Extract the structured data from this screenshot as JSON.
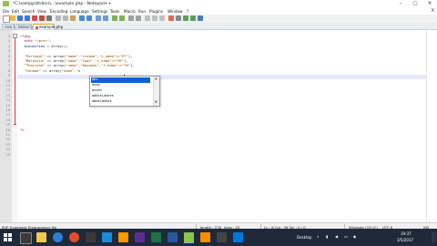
{
  "window": {
    "title": "*C:\\xampp\\htdocs\\...\\example.php - Notepad++",
    "buttons": [
      "–",
      "▢",
      "✕"
    ]
  },
  "menu": [
    "File",
    "Edit",
    "Search",
    "View",
    "Encoding",
    "Language",
    "Settings",
    "Tools",
    "Macro",
    "Run",
    "Plugins",
    "Window",
    "?"
  ],
  "menu_close": "X",
  "tabs": [
    {
      "label": "new 1",
      "state": "inactive"
    },
    {
      "label": "bbiberi.php",
      "state": "inactive"
    },
    {
      "label": "example.php",
      "state": "active"
    }
  ],
  "code": {
    "line_numbers": [
      "1",
      "2",
      "3",
      "4",
      "5",
      "6",
      "7",
      "8",
      "9",
      "10",
      "11",
      "12",
      "13",
      "14",
      "15",
      "16",
      "17",
      "18",
      "19",
      "20",
      "21",
      "22",
      "23",
      "24",
      "25"
    ],
    "lines": [
      [
        {
          "t": "<?php",
          "c": "tag"
        }
      ],
      [
        {
          "t": "  echo ",
          "c": "kw"
        },
        {
          "t": "\"<pre>\";",
          "c": "st"
        }
      ],
      [
        {
          "t": "  $countries",
          "c": "var"
        },
        {
          "t": " = array();",
          "c": "op"
        }
      ],
      [
        {
          "t": "",
          "c": "op"
        }
      ],
      [
        {
          "t": "  \"Portugal\"",
          "c": "st"
        },
        {
          "t": " => array(",
          "c": "op"
        },
        {
          "t": "\"name\",\"Lisbon\",\"t_name\"=>\"PT\"",
          "c": "st"
        },
        {
          "t": "),",
          "c": "op"
        }
      ],
      [
        {
          "t": "  \"Malaysia\"",
          "c": "st"
        },
        {
          "t": " => array(",
          "c": "op"
        },
        {
          "t": "\"name\",\"Ipoh\",\"t_name\"=>\"MY\"",
          "c": "st"
        },
        {
          "t": "),",
          "c": "op"
        }
      ],
      [
        {
          "t": "  \"Thailand\"",
          "c": "st"
        },
        {
          "t": " => array(",
          "c": "op"
        },
        {
          "t": "\"name\",\"Bangkok\",\"t_name\"=>\"TH\"",
          "c": "st"
        },
        {
          "t": "),",
          "c": "op"
        }
      ],
      [
        {
          "t": "  \"Canada\"",
          "c": "st"
        },
        {
          "t": " => array(",
          "c": "op"
        },
        {
          "t": "\"name\",\"a",
          "c": "st"
        },
        {
          "t": "",
          "c": "op"
        }
      ],
      [
        {
          "t": "",
          "c": "op"
        }
      ],
      [
        {
          "t": "",
          "c": "op"
        }
      ],
      [
        {
          "t": "",
          "c": "op"
        }
      ],
      [
        {
          "t": "",
          "c": "op"
        }
      ],
      [
        {
          "t": "",
          "c": "op"
        }
      ],
      [
        {
          "t": "",
          "c": "op"
        }
      ],
      [
        {
          "t": "",
          "c": "op"
        }
      ],
      [
        {
          "t": "",
          "c": "op"
        }
      ],
      [
        {
          "t": "",
          "c": "op"
        }
      ],
      [
        {
          "t": "",
          "c": "op"
        }
      ],
      [
        {
          "t": "",
          "c": "op"
        }
      ],
      [
        {
          "t": "?>",
          "c": "tag"
        }
      ],
      [
        {
          "t": "",
          "c": "op"
        }
      ],
      [
        {
          "t": "",
          "c": "op"
        }
      ],
      [
        {
          "t": "",
          "c": "op"
        }
      ],
      [
        {
          "t": "",
          "c": "op"
        }
      ],
      [
        {
          "t": "",
          "c": "op"
        }
      ]
    ]
  },
  "autocomplete": {
    "items": [
      "abs",
      "acos",
      "acosh",
      "addcslashes",
      "addslashes"
    ],
    "selected": "abs"
  },
  "status": {
    "type": "PHP Hypertext Preprocessor file",
    "length": "length : 278",
    "lines": "lines : 25",
    "position": "Ln : 8   Col : 36   Sel : 0 | 0",
    "eol": "Windows (CR LF)",
    "encoding": "UTF-8",
    "mode": "INS"
  },
  "taskbar": {
    "desktop": "Desktop",
    "time": "19:37",
    "date": "3/5/2017"
  },
  "colors": {
    "accent": "#0a64d4",
    "taskbar": "#1e2a3a",
    "fold_marker": "#e04040"
  }
}
